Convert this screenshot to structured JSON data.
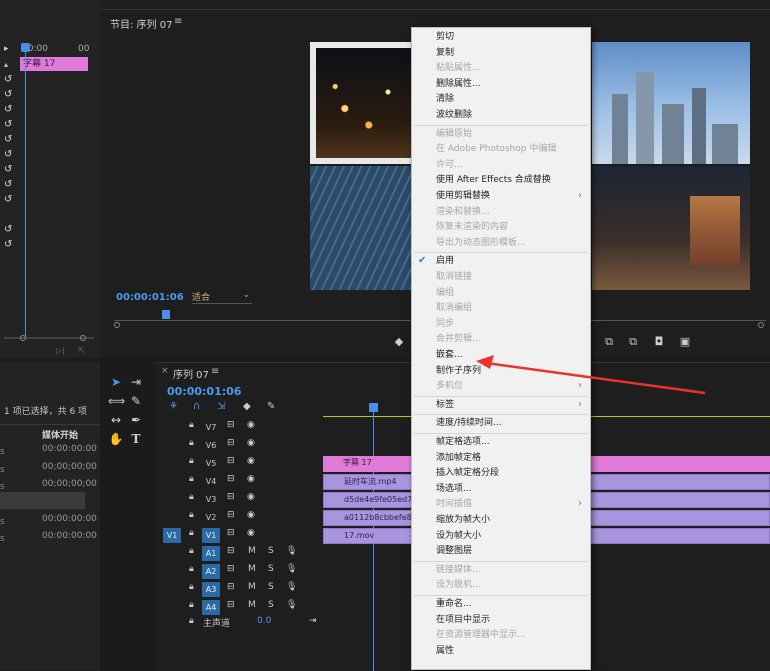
{
  "left_panel": {
    "ruler_start": "00:00",
    "ruler_end": "00",
    "caption_clip": "字幕 17"
  },
  "program_monitor": {
    "title": "节目: 序列 07",
    "timecode": "00:00:01:06",
    "zoom": "适合"
  },
  "project_panel": {
    "status": "1 项已选择，共 6 项",
    "column": "媒体开始",
    "rows": [
      "00:00:00:00",
      "00;00;00;00",
      "00;00;00;00",
      "",
      "00:00:00:00",
      "00:00:00:00"
    ]
  },
  "timeline": {
    "title": "序列 07",
    "timecode": "00:00:01:06",
    "video_tracks": [
      {
        "label": "V7",
        "clip": ""
      },
      {
        "label": "V6",
        "clip": ""
      },
      {
        "label": "V5",
        "clip": "字幕 17"
      },
      {
        "label": "V4",
        "clip": "延时车流.mp4"
      },
      {
        "label": "V3",
        "clip": "d5de4e9fe05ed7245e3"
      },
      {
        "label": "V2",
        "clip": "a0112b8cbbefe89c508"
      },
      {
        "label": "V1",
        "clip": "17.mov"
      }
    ],
    "audio_tracks": [
      {
        "label": "A1"
      },
      {
        "label": "A2"
      },
      {
        "label": "A3"
      },
      {
        "label": "A4"
      }
    ],
    "source_patch_v": "V1",
    "master_label": "主声道",
    "master_value": "0.0",
    "track_buttons": {
      "mute": "M",
      "solo": "S"
    }
  },
  "context_menu": {
    "items": [
      {
        "label": "剪切",
        "enabled": true
      },
      {
        "label": "复制",
        "enabled": true
      },
      {
        "label": "粘贴属性...",
        "enabled": false
      },
      {
        "label": "删除属性...",
        "enabled": true
      },
      {
        "label": "清除",
        "enabled": true
      },
      {
        "label": "波纹删除",
        "enabled": true
      },
      {
        "sep": true
      },
      {
        "label": "编辑原始",
        "enabled": false
      },
      {
        "label": "在 Adobe Photoshop 中编辑",
        "enabled": false
      },
      {
        "label": "许可...",
        "enabled": false
      },
      {
        "label": "使用 After Effects 合成替换",
        "enabled": true
      },
      {
        "label": "使用剪辑替换",
        "enabled": true,
        "submenu": true
      },
      {
        "label": "渲染和替换...",
        "enabled": false
      },
      {
        "label": "恢复未渲染的内容",
        "enabled": false
      },
      {
        "label": "导出为动态图形模板...",
        "enabled": false
      },
      {
        "sep": true
      },
      {
        "label": "启用",
        "enabled": true,
        "checked": true
      },
      {
        "label": "取消链接",
        "enabled": false
      },
      {
        "label": "编组",
        "enabled": false
      },
      {
        "label": "取消编组",
        "enabled": false
      },
      {
        "label": "同步",
        "enabled": false
      },
      {
        "label": "合并剪辑...",
        "enabled": false
      },
      {
        "label": "嵌套...",
        "enabled": true
      },
      {
        "label": "制作子序列",
        "enabled": true
      },
      {
        "label": "多机位",
        "enabled": false,
        "submenu": true
      },
      {
        "sep": true
      },
      {
        "label": "标签",
        "enabled": true,
        "submenu": true
      },
      {
        "sep": true
      },
      {
        "label": "速度/持续时间...",
        "enabled": true
      },
      {
        "sep": true
      },
      {
        "label": "帧定格选项...",
        "enabled": true
      },
      {
        "label": "添加帧定格",
        "enabled": true
      },
      {
        "label": "插入帧定格分段",
        "enabled": true
      },
      {
        "label": "场选项...",
        "enabled": true
      },
      {
        "label": "时间插值",
        "enabled": false,
        "submenu": true
      },
      {
        "label": "缩放为帧大小",
        "enabled": true
      },
      {
        "label": "设为帧大小",
        "enabled": true
      },
      {
        "label": "调整图层",
        "enabled": true
      },
      {
        "sep": true
      },
      {
        "label": "链接媒体...",
        "enabled": false
      },
      {
        "label": "设为脱机...",
        "enabled": false
      },
      {
        "sep": true
      },
      {
        "label": "重命名...",
        "enabled": true
      },
      {
        "label": "在项目中显示",
        "enabled": true
      },
      {
        "label": "在资源管理器中显示...",
        "enabled": false
      },
      {
        "label": "属性",
        "enabled": true
      }
    ]
  },
  "colors": {
    "accent_blue": "#4a9cf0",
    "clip_purple": "#a995dd",
    "clip_pink": "#e07ad9",
    "annotation_red": "#e8342c"
  }
}
